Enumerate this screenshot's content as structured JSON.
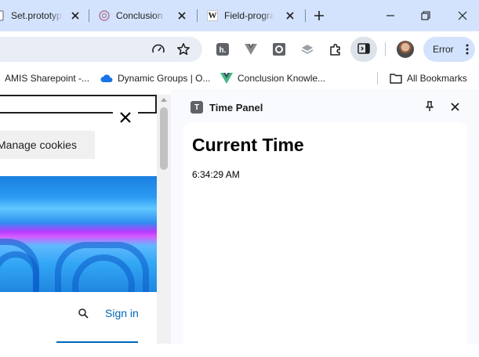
{
  "tabs": [
    {
      "title": "Set.prototype",
      "favicon": "page-icon"
    },
    {
      "title": "Conclusion - ",
      "favicon": "swirl-icon"
    },
    {
      "title": "Field-progra",
      "favicon": "wikipedia-icon"
    }
  ],
  "toolbar": {
    "error_label": "Error"
  },
  "bookmarks": [
    {
      "label": "AMIS Sharepoint -...",
      "icon": "sharepoint-icon"
    },
    {
      "label": "Dynamic Groups | O...",
      "icon": "cloud-icon"
    },
    {
      "label": "Conclusion Knowle...",
      "icon": "vue-icon"
    }
  ],
  "all_bookmarks": "All Bookmarks",
  "page": {
    "cookies_button": "Manage cookies",
    "sign_in": "Sign in"
  },
  "side_panel": {
    "app_icon_letter": "T",
    "title": "Time Panel",
    "heading": "Current Time",
    "time": "6:34:29 AM"
  },
  "colors": {
    "tabstrip": "#d3e3fd",
    "accent": "#0067b8",
    "panel_bg": "#f8fafd"
  }
}
